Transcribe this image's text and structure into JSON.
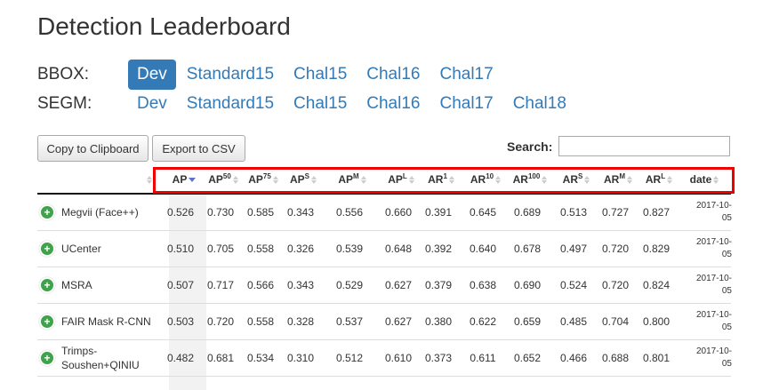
{
  "page": {
    "title": "Detection Leaderboard"
  },
  "bbox": {
    "label": "BBOX:",
    "options": [
      "Dev",
      "Standard15",
      "Chal15",
      "Chal16",
      "Chal17"
    ],
    "active": "Dev"
  },
  "segm": {
    "label": "SEGM:",
    "options": [
      "Dev",
      "Standard15",
      "Chal15",
      "Chal16",
      "Chal17",
      "Chal18"
    ]
  },
  "toolbar": {
    "copy_label": "Copy to Clipboard",
    "csv_label": "Export to CSV",
    "search_label": "Search:",
    "search_value": ""
  },
  "columns": [
    {
      "base": "AP",
      "sup": ""
    },
    {
      "base": "AP",
      "sup": "50"
    },
    {
      "base": "AP",
      "sup": "75"
    },
    {
      "base": "AP",
      "sup": "S"
    },
    {
      "base": "AP",
      "sup": "M"
    },
    {
      "base": "AP",
      "sup": "L"
    },
    {
      "base": "AR",
      "sup": "1"
    },
    {
      "base": "AR",
      "sup": "10"
    },
    {
      "base": "AR",
      "sup": "100"
    },
    {
      "base": "AR",
      "sup": "S"
    },
    {
      "base": "AR",
      "sup": "M"
    },
    {
      "base": "AR",
      "sup": "L"
    },
    {
      "base": "date",
      "sup": ""
    }
  ],
  "rows": [
    {
      "name": "Megvii (Face++)",
      "values": [
        "0.526",
        "0.730",
        "0.585",
        "0.343",
        "0.556",
        "0.660",
        "0.391",
        "0.645",
        "0.689",
        "0.513",
        "0.727",
        "0.827"
      ],
      "date": "2017-10-05"
    },
    {
      "name": "UCenter",
      "values": [
        "0.510",
        "0.705",
        "0.558",
        "0.326",
        "0.539",
        "0.648",
        "0.392",
        "0.640",
        "0.678",
        "0.497",
        "0.720",
        "0.829"
      ],
      "date": "2017-10-05"
    },
    {
      "name": "MSRA",
      "values": [
        "0.507",
        "0.717",
        "0.566",
        "0.343",
        "0.529",
        "0.627",
        "0.379",
        "0.638",
        "0.690",
        "0.524",
        "0.720",
        "0.824"
      ],
      "date": "2017-10-05"
    },
    {
      "name": "FAIR Mask R-CNN",
      "values": [
        "0.503",
        "0.720",
        "0.558",
        "0.328",
        "0.537",
        "0.627",
        "0.380",
        "0.622",
        "0.659",
        "0.485",
        "0.704",
        "0.800"
      ],
      "date": "2017-10-05"
    },
    {
      "name": "Trimps-Soushen+QINIU",
      "values": [
        "0.482",
        "0.681",
        "0.534",
        "0.310",
        "0.512",
        "0.610",
        "0.373",
        "0.611",
        "0.652",
        "0.466",
        "0.688",
        "0.801"
      ],
      "date": "2017-10-05"
    }
  ]
}
